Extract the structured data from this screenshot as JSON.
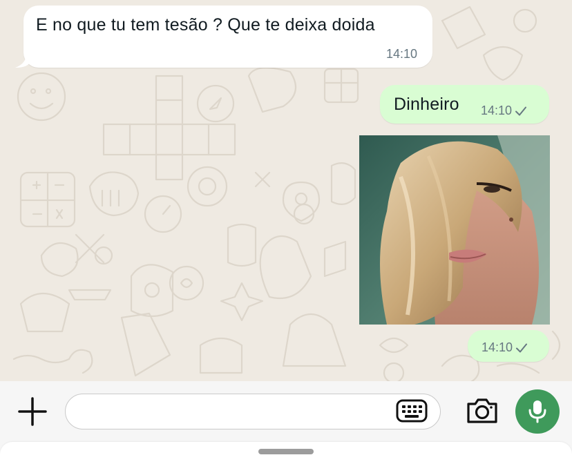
{
  "messages": [
    {
      "direction": "incoming",
      "text": "E no que tu tem tesão ? Que te deixa doida",
      "time": "14:10"
    },
    {
      "direction": "outgoing",
      "text": "Dinheiro",
      "time": "14:10",
      "status": "sent-check-icon"
    },
    {
      "direction": "outgoing",
      "type": "photo",
      "time": "14:10",
      "status": "sent-check-icon"
    }
  ],
  "composer": {
    "value": "",
    "placeholder": "",
    "icons": [
      "plus-icon",
      "keyboard-sticker-icon",
      "camera-icon",
      "microphone-icon"
    ]
  },
  "colors": {
    "chat_background": "#efeae2",
    "incoming_bubble": "#ffffff",
    "outgoing_bubble": "#d9fdd3",
    "timestamp": "#667781",
    "mic_button": "#3f9a5b"
  }
}
